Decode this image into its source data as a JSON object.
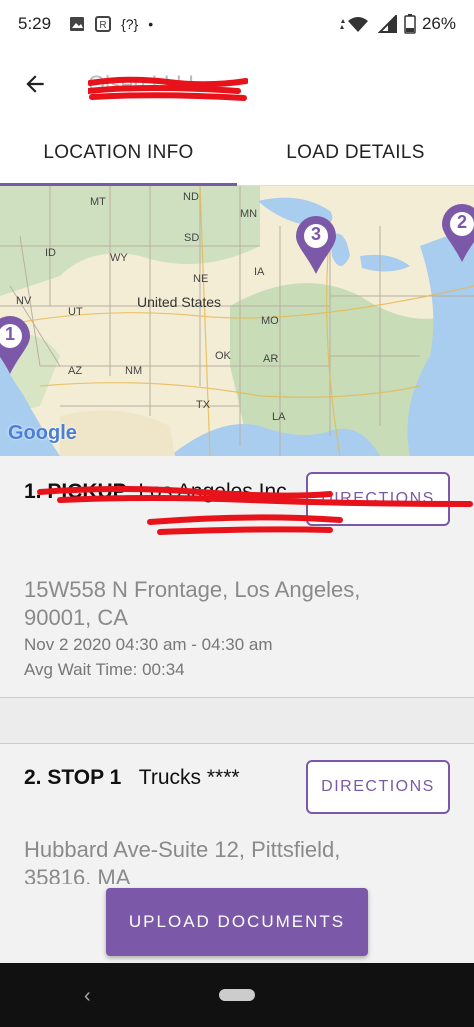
{
  "status_bar": {
    "time": "5:29",
    "icons": [
      "image-icon",
      "r-app-icon",
      "{?}",
      "•"
    ],
    "battery": "26%"
  },
  "app_bar": {
    "title": "Olsen LLLL"
  },
  "tabs": [
    {
      "label": "LOCATION INFO",
      "active": true
    },
    {
      "label": "LOAD DETAILS",
      "active": false
    }
  ],
  "map": {
    "country_label": "United States",
    "state_labels": [
      "MT",
      "ND",
      "MN",
      "SD",
      "ID",
      "WY",
      "IA",
      "NE",
      "NV",
      "UT",
      "MO",
      "OK",
      "AR",
      "AZ",
      "NM",
      "TX",
      "LA"
    ],
    "markers": [
      "1",
      "3",
      "2"
    ],
    "logo": "Google"
  },
  "stops": [
    {
      "title_bold": "1. PICKUP",
      "title_rest": "Los Angeles Inc",
      "directions_label": "DIRECTIONS",
      "address": "15W558 N Frontage, Los Angeles, 90001, CA",
      "date": "Nov 2 2020 04:30 am - 04:30 am",
      "wait": "Avg Wait Time: 00:34"
    },
    {
      "title_bold": "2. STOP 1",
      "title_rest": "Trucks ****",
      "directions_label": "DIRECTIONS",
      "address": "Hubbard Ave-Suite 12, Pittsfield, 35816, MA"
    }
  ],
  "upload_label": "UPLOAD DOCUMENTS",
  "colors": {
    "accent": "#7b59a8",
    "redaction": "#e8121b"
  }
}
